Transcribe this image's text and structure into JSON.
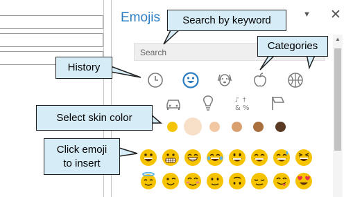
{
  "pane": {
    "title": "Emojis",
    "dropdown_icon": "caret-down-icon",
    "close_label": "✕"
  },
  "search": {
    "placeholder": "Search"
  },
  "categories": [
    {
      "name": "history",
      "icon": "clock-icon"
    },
    {
      "name": "smileys",
      "icon": "smiley-face-icon",
      "selected": true
    },
    {
      "name": "animals",
      "icon": "dog-face-icon"
    },
    {
      "name": "food",
      "icon": "apple-icon"
    },
    {
      "name": "activities",
      "icon": "basketball-icon"
    },
    {
      "name": "travel",
      "icon": "car-icon"
    },
    {
      "name": "objects",
      "icon": "lightbulb-icon"
    },
    {
      "name": "symbols",
      "icon": "symbols-icon"
    },
    {
      "name": "flags",
      "icon": "flag-icon"
    }
  ],
  "skin_tones": [
    "#f5c400",
    "#f7dfc8",
    "#f2c7a3",
    "#d9a06f",
    "#a96f3c",
    "#5a3a24"
  ],
  "callouts": {
    "search": "Search by keyword",
    "categories": "Categories",
    "history": "History",
    "skin": "Select skin color",
    "click_line1": "Click emoji",
    "click_line2": "to insert"
  },
  "colors": {
    "accent": "#2b7bc0",
    "callout_fill": "#d6ecf7",
    "emoji_yellow": "#f6c300"
  }
}
